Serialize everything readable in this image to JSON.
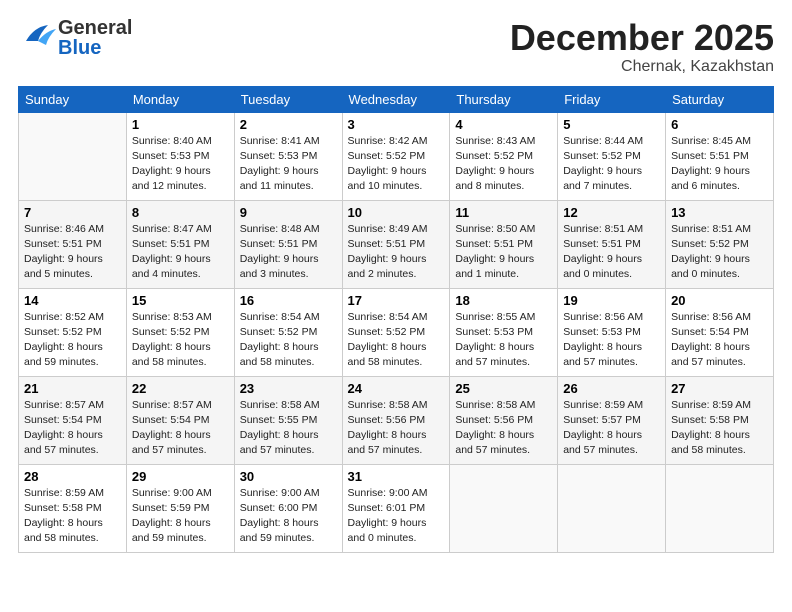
{
  "header": {
    "logo_general": "General",
    "logo_blue": "Blue",
    "main_title": "December 2025",
    "subtitle": "Chernak, Kazakhstan"
  },
  "calendar": {
    "days_of_week": [
      "Sunday",
      "Monday",
      "Tuesday",
      "Wednesday",
      "Thursday",
      "Friday",
      "Saturday"
    ],
    "weeks": [
      [
        {
          "day": "",
          "sunrise": "",
          "sunset": "",
          "daylight": ""
        },
        {
          "day": "1",
          "sunrise": "Sunrise: 8:40 AM",
          "sunset": "Sunset: 5:53 PM",
          "daylight": "Daylight: 9 hours and 12 minutes."
        },
        {
          "day": "2",
          "sunrise": "Sunrise: 8:41 AM",
          "sunset": "Sunset: 5:53 PM",
          "daylight": "Daylight: 9 hours and 11 minutes."
        },
        {
          "day": "3",
          "sunrise": "Sunrise: 8:42 AM",
          "sunset": "Sunset: 5:52 PM",
          "daylight": "Daylight: 9 hours and 10 minutes."
        },
        {
          "day": "4",
          "sunrise": "Sunrise: 8:43 AM",
          "sunset": "Sunset: 5:52 PM",
          "daylight": "Daylight: 9 hours and 8 minutes."
        },
        {
          "day": "5",
          "sunrise": "Sunrise: 8:44 AM",
          "sunset": "Sunset: 5:52 PM",
          "daylight": "Daylight: 9 hours and 7 minutes."
        },
        {
          "day": "6",
          "sunrise": "Sunrise: 8:45 AM",
          "sunset": "Sunset: 5:51 PM",
          "daylight": "Daylight: 9 hours and 6 minutes."
        }
      ],
      [
        {
          "day": "7",
          "sunrise": "Sunrise: 8:46 AM",
          "sunset": "Sunset: 5:51 PM",
          "daylight": "Daylight: 9 hours and 5 minutes."
        },
        {
          "day": "8",
          "sunrise": "Sunrise: 8:47 AM",
          "sunset": "Sunset: 5:51 PM",
          "daylight": "Daylight: 9 hours and 4 minutes."
        },
        {
          "day": "9",
          "sunrise": "Sunrise: 8:48 AM",
          "sunset": "Sunset: 5:51 PM",
          "daylight": "Daylight: 9 hours and 3 minutes."
        },
        {
          "day": "10",
          "sunrise": "Sunrise: 8:49 AM",
          "sunset": "Sunset: 5:51 PM",
          "daylight": "Daylight: 9 hours and 2 minutes."
        },
        {
          "day": "11",
          "sunrise": "Sunrise: 8:50 AM",
          "sunset": "Sunset: 5:51 PM",
          "daylight": "Daylight: 9 hours and 1 minute."
        },
        {
          "day": "12",
          "sunrise": "Sunrise: 8:51 AM",
          "sunset": "Sunset: 5:51 PM",
          "daylight": "Daylight: 9 hours and 0 minutes."
        },
        {
          "day": "13",
          "sunrise": "Sunrise: 8:51 AM",
          "sunset": "Sunset: 5:52 PM",
          "daylight": "Daylight: 9 hours and 0 minutes."
        }
      ],
      [
        {
          "day": "14",
          "sunrise": "Sunrise: 8:52 AM",
          "sunset": "Sunset: 5:52 PM",
          "daylight": "Daylight: 8 hours and 59 minutes."
        },
        {
          "day": "15",
          "sunrise": "Sunrise: 8:53 AM",
          "sunset": "Sunset: 5:52 PM",
          "daylight": "Daylight: 8 hours and 58 minutes."
        },
        {
          "day": "16",
          "sunrise": "Sunrise: 8:54 AM",
          "sunset": "Sunset: 5:52 PM",
          "daylight": "Daylight: 8 hours and 58 minutes."
        },
        {
          "day": "17",
          "sunrise": "Sunrise: 8:54 AM",
          "sunset": "Sunset: 5:52 PM",
          "daylight": "Daylight: 8 hours and 58 minutes."
        },
        {
          "day": "18",
          "sunrise": "Sunrise: 8:55 AM",
          "sunset": "Sunset: 5:53 PM",
          "daylight": "Daylight: 8 hours and 57 minutes."
        },
        {
          "day": "19",
          "sunrise": "Sunrise: 8:56 AM",
          "sunset": "Sunset: 5:53 PM",
          "daylight": "Daylight: 8 hours and 57 minutes."
        },
        {
          "day": "20",
          "sunrise": "Sunrise: 8:56 AM",
          "sunset": "Sunset: 5:54 PM",
          "daylight": "Daylight: 8 hours and 57 minutes."
        }
      ],
      [
        {
          "day": "21",
          "sunrise": "Sunrise: 8:57 AM",
          "sunset": "Sunset: 5:54 PM",
          "daylight": "Daylight: 8 hours and 57 minutes."
        },
        {
          "day": "22",
          "sunrise": "Sunrise: 8:57 AM",
          "sunset": "Sunset: 5:54 PM",
          "daylight": "Daylight: 8 hours and 57 minutes."
        },
        {
          "day": "23",
          "sunrise": "Sunrise: 8:58 AM",
          "sunset": "Sunset: 5:55 PM",
          "daylight": "Daylight: 8 hours and 57 minutes."
        },
        {
          "day": "24",
          "sunrise": "Sunrise: 8:58 AM",
          "sunset": "Sunset: 5:56 PM",
          "daylight": "Daylight: 8 hours and 57 minutes."
        },
        {
          "day": "25",
          "sunrise": "Sunrise: 8:58 AM",
          "sunset": "Sunset: 5:56 PM",
          "daylight": "Daylight: 8 hours and 57 minutes."
        },
        {
          "day": "26",
          "sunrise": "Sunrise: 8:59 AM",
          "sunset": "Sunset: 5:57 PM",
          "daylight": "Daylight: 8 hours and 57 minutes."
        },
        {
          "day": "27",
          "sunrise": "Sunrise: 8:59 AM",
          "sunset": "Sunset: 5:58 PM",
          "daylight": "Daylight: 8 hours and 58 minutes."
        }
      ],
      [
        {
          "day": "28",
          "sunrise": "Sunrise: 8:59 AM",
          "sunset": "Sunset: 5:58 PM",
          "daylight": "Daylight: 8 hours and 58 minutes."
        },
        {
          "day": "29",
          "sunrise": "Sunrise: 9:00 AM",
          "sunset": "Sunset: 5:59 PM",
          "daylight": "Daylight: 8 hours and 59 minutes."
        },
        {
          "day": "30",
          "sunrise": "Sunrise: 9:00 AM",
          "sunset": "Sunset: 6:00 PM",
          "daylight": "Daylight: 8 hours and 59 minutes."
        },
        {
          "day": "31",
          "sunrise": "Sunrise: 9:00 AM",
          "sunset": "Sunset: 6:01 PM",
          "daylight": "Daylight: 9 hours and 0 minutes."
        },
        {
          "day": "",
          "sunrise": "",
          "sunset": "",
          "daylight": ""
        },
        {
          "day": "",
          "sunrise": "",
          "sunset": "",
          "daylight": ""
        },
        {
          "day": "",
          "sunrise": "",
          "sunset": "",
          "daylight": ""
        }
      ]
    ]
  }
}
